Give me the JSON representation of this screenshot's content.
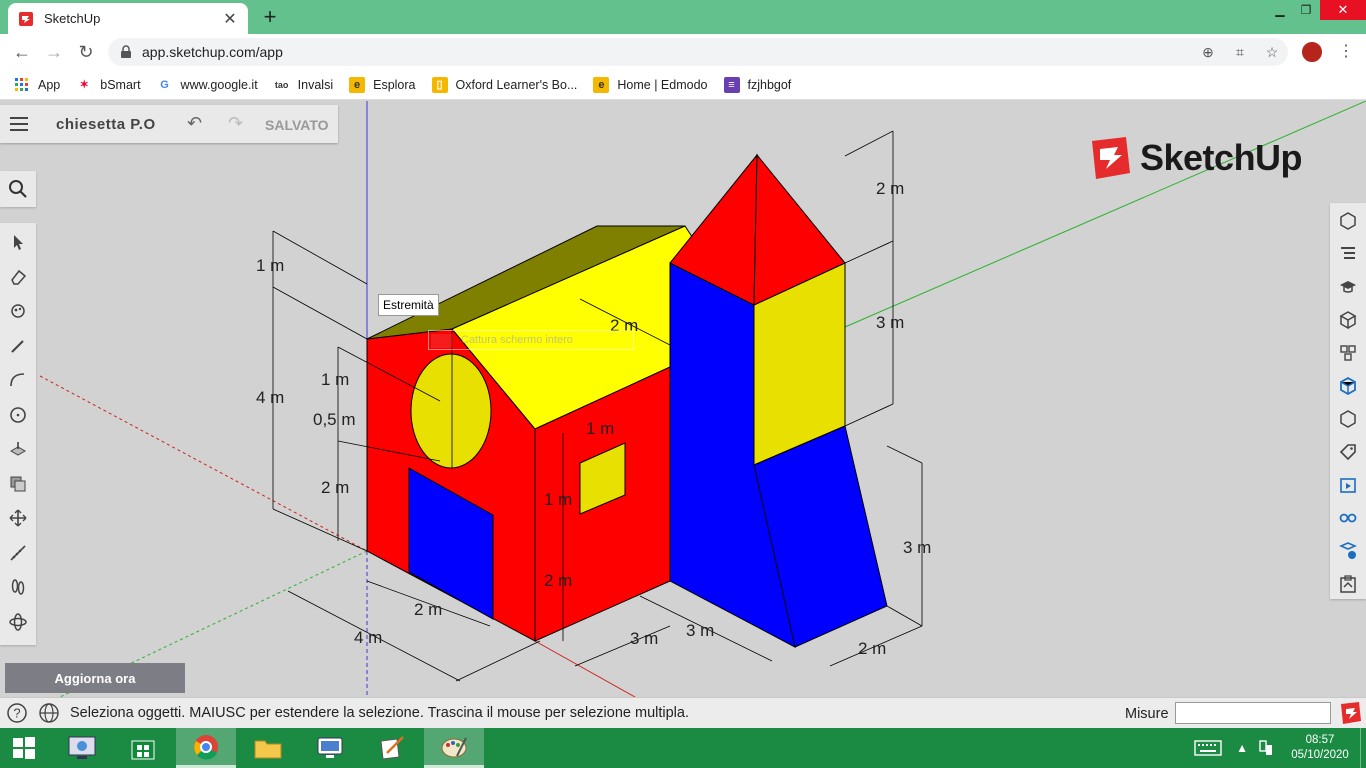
{
  "browser": {
    "tab_title": "SketchUp",
    "url": "app.sketchup.com/app",
    "bookmarks": [
      {
        "label": "App",
        "icon": "apps-grid-icon"
      },
      {
        "label": "bSmart",
        "icon": "star-icon"
      },
      {
        "label": "www.google.it",
        "icon": "google-icon"
      },
      {
        "label": "Invalsi",
        "icon": "tao-icon"
      },
      {
        "label": "Esplora",
        "icon": "edmodo-e-icon"
      },
      {
        "label": "Oxford Learner's Bo...",
        "icon": "bookmark-doc-icon"
      },
      {
        "label": "Home | Edmodo",
        "icon": "edmodo-e-icon"
      },
      {
        "label": "fzjhbgof",
        "icon": "list-icon"
      }
    ]
  },
  "app": {
    "doc_name": "chiesetta P.O",
    "save_status": "SALVATO",
    "update_button": "Aggiorna ora",
    "logo_text": "SketchUp",
    "tooltip": "Estremità",
    "ghost_label": "Cattura schermo intero",
    "dimensions": [
      "1 m",
      "4 m",
      "1 m",
      "0,5 m",
      "2 m",
      "2 m",
      "4 m",
      "2 m",
      "1 m",
      "1 m",
      "2 m",
      "3 m",
      "3 m",
      "2 m",
      "3 m",
      "3 m",
      "2 m"
    ],
    "left_tools": [
      "select-arrow-icon",
      "eraser-icon",
      "paint-bucket-icon",
      "pencil-icon",
      "arc-icon",
      "circle-icon",
      "push-pull-icon",
      "offset-icon",
      "move-icon",
      "tape-measure-icon",
      "walk-icon",
      "orbit-icon"
    ],
    "right_tools": [
      "entity-info-icon",
      "outliner-icon",
      "instructor-icon",
      "components-icon",
      "materials-icon",
      "styles-icon",
      "scenes-icon",
      "tags-icon",
      "animation-icon",
      "display-icon",
      "views-icon",
      "solid-inspector-icon"
    ]
  },
  "status": {
    "message": "Seleziona oggetti. MAIUSC per estendere la selezione. Trascina il mouse per selezione multipla.",
    "measure_label": "Misure"
  },
  "taskbar": {
    "time": "08:57",
    "date": "05/10/2020"
  },
  "colors": {
    "tab_bar": "#62c18c",
    "taskbar": "#1b8a43",
    "red_face": "#ff0000",
    "yellow_face": "#ffff00",
    "blue_face": "#0000ff",
    "roof": "#808000"
  }
}
